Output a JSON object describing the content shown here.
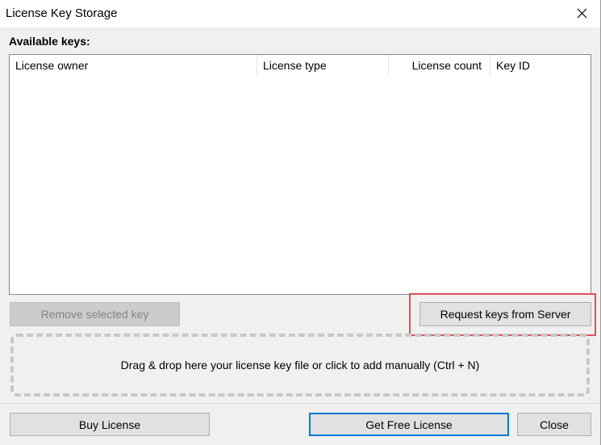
{
  "window": {
    "title": "License Key Storage"
  },
  "keys": {
    "section_label": "Available keys:",
    "columns": [
      "License owner",
      "License type",
      "License count",
      "Key ID"
    ],
    "rows": []
  },
  "actions": {
    "remove_label": "Remove selected key",
    "remove_enabled": false,
    "request_label": "Request keys from Server"
  },
  "dropzone": {
    "text": "Drag & drop here your license key file or click to add manually (Ctrl + N)"
  },
  "footer": {
    "buy_label": "Buy License",
    "free_label": "Get Free License",
    "close_label": "Close"
  },
  "colors": {
    "highlight": "#e0505a",
    "default_button_border": "#0078d7"
  },
  "icons": {
    "close": "close-icon"
  }
}
